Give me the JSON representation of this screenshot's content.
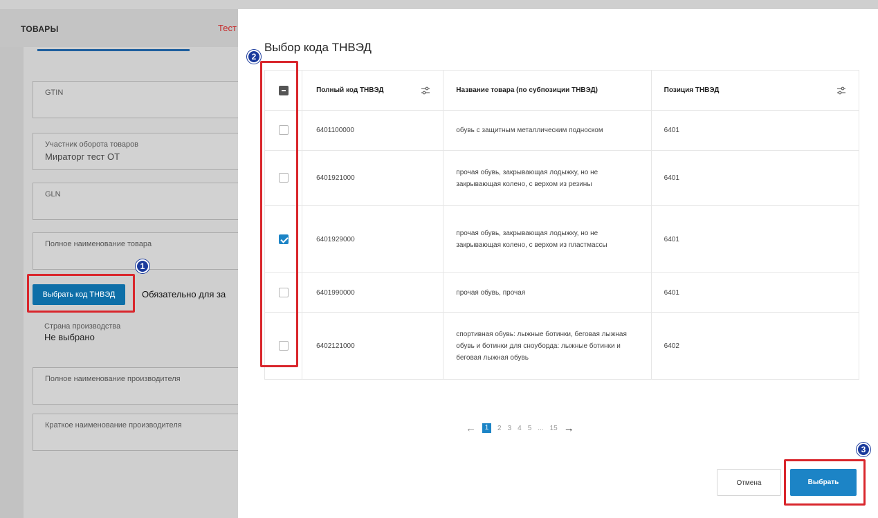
{
  "background": {
    "header_title": "ТОВАРЫ",
    "header_tab_partial": "Тест",
    "fields": [
      {
        "label": "GTIN",
        "value": ""
      },
      {
        "label": "Участник оборота товаров",
        "value": "Мираторг тест ОТ"
      },
      {
        "label": "GLN",
        "value": ""
      },
      {
        "label": "Полное наименование товара",
        "value": ""
      }
    ],
    "select_button_label": "Выбрать код ТНВЭД",
    "required_note": "Обязательно для за",
    "fields_after": [
      {
        "label": "Страна производства",
        "value": "Не выбрано"
      },
      {
        "label": "Полное наименование производителя",
        "value": ""
      },
      {
        "label": "Краткое наименование производителя",
        "value": ""
      }
    ]
  },
  "annotations": {
    "badge_1": "1",
    "badge_2": "2",
    "badge_3": "3",
    "highlight_color": "#d9262c",
    "badge_color": "#1a3a9c"
  },
  "modal": {
    "title": "Выбор кода ТНВЭД",
    "columns": {
      "code": "Полный код ТНВЭД",
      "name": "Название товара (по субпозиции ТНВЭД)",
      "position": "Позиция ТНВЭД"
    },
    "rows": [
      {
        "code": "6401100000",
        "name": "обувь с защитным металлическим подноском",
        "position": "6401",
        "checked": false
      },
      {
        "code": "6401921000",
        "name": "прочая обувь, закрывающая лодыжку, но не закрывающая колено, с верхом из резины",
        "position": "6401",
        "checked": false
      },
      {
        "code": "6401929000",
        "name": "прочая обувь, закрывающая лодыжку, но не закрывающая колено, с верхом из пластмассы",
        "position": "6401",
        "checked": true
      },
      {
        "code": "6401990000",
        "name": "прочая обувь, прочая",
        "position": "6401",
        "checked": false
      },
      {
        "code": "6402121000",
        "name": "спортивная обувь: лыжные ботинки, беговая лыжная обувь и ботинки для сноуборда: лыжные ботинки и беговая лыжная обувь",
        "position": "6402",
        "checked": false
      }
    ],
    "pagination": {
      "prev": "←",
      "pages": [
        "1",
        "2",
        "3",
        "4",
        "5",
        "...",
        "15"
      ],
      "current": "1",
      "next": "→"
    },
    "cancel_label": "Отмена",
    "confirm_label": "Выбрать",
    "accent_color": "#1c84c6"
  }
}
